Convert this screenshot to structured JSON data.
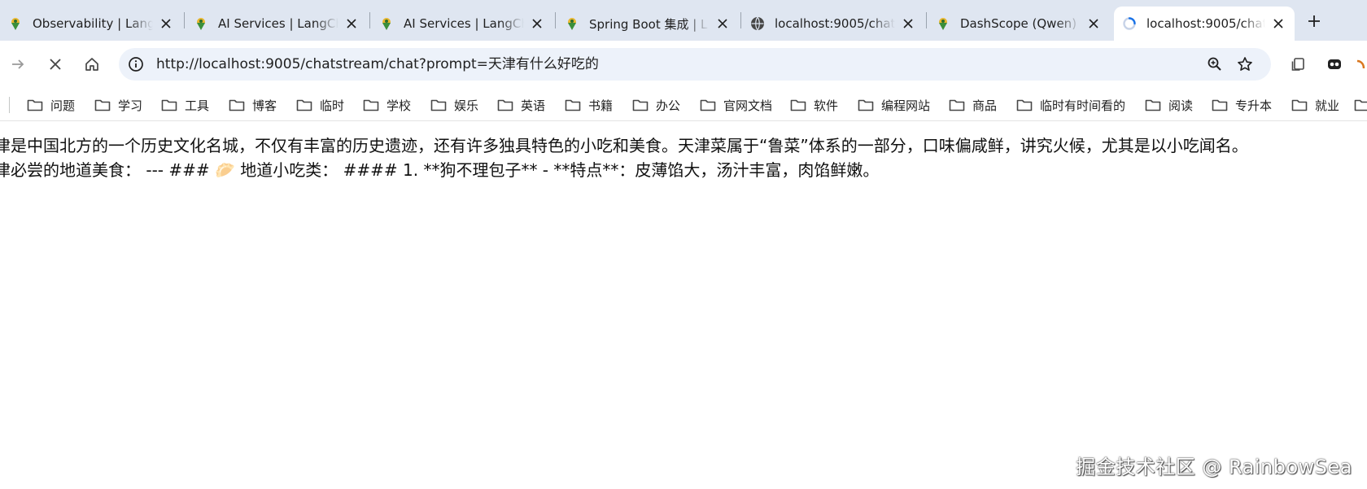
{
  "browser": {
    "tabs": [
      {
        "title": "Observability | Lang",
        "favicon": "langchain-parrot-icon"
      },
      {
        "title": "AI Services | LangCh",
        "favicon": "langchain-parrot-icon"
      },
      {
        "title": "AI Services | LangCh",
        "favicon": "langchain-parrot-icon"
      },
      {
        "title": "Spring Boot 集成 | L",
        "favicon": "langchain-parrot-icon"
      },
      {
        "title": "localhost:9005/chat",
        "favicon": "globe-icon"
      },
      {
        "title": "DashScope (Qwen)",
        "favicon": "langchain-parrot-icon"
      },
      {
        "title": "localhost:9005/chat",
        "favicon": "loading-spinner-icon",
        "active": true
      }
    ],
    "new_tab_icon": "plus-icon",
    "address_bar": {
      "url": "http://localhost:9005/chatstream/chat?prompt=天津有什么好吃的"
    },
    "bookmarks": [
      "问题",
      "学习",
      "工具",
      "博客",
      "临时",
      "学校",
      "娱乐",
      "英语",
      "书籍",
      "办公",
      "官网文档",
      "软件",
      "编程网站",
      "商品",
      "临时有时间看的",
      "阅读",
      "专升本",
      "就业"
    ]
  },
  "page": {
    "lines": [
      "津是中国北方的一个历史文化名城，不仅有丰富的历史遗迹，还有许多独具特色的小吃和美食。天津菜属于“鲁菜”体系的一部分，口味偏咸鲜，讲究火候，尤其是以小吃闻名。",
      "津必尝的地道美食： --- ### 🥟 地道小吃类： #### 1. **狗不理包子** - **特点**：皮薄馅大，汤汁丰富，肉馅鲜嫩。"
    ],
    "watermark": "掘金技术社区 @ RainbowSea"
  },
  "colors": {
    "tabstrip_bg": "#dfe6f1",
    "omnibox_bg": "#edf2fa",
    "icon_color": "#474747"
  }
}
